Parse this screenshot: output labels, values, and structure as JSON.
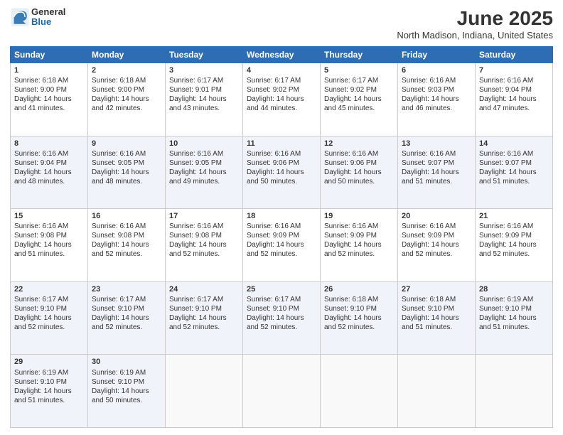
{
  "header": {
    "logo_general": "General",
    "logo_blue": "Blue",
    "month_year": "June 2025",
    "location": "North Madison, Indiana, United States"
  },
  "days_of_week": [
    "Sunday",
    "Monday",
    "Tuesday",
    "Wednesday",
    "Thursday",
    "Friday",
    "Saturday"
  ],
  "weeks": [
    [
      {
        "day": "1",
        "sunrise": "6:18 AM",
        "sunset": "9:00 PM",
        "daylight": "14 hours and 41 minutes."
      },
      {
        "day": "2",
        "sunrise": "6:18 AM",
        "sunset": "9:00 PM",
        "daylight": "14 hours and 42 minutes."
      },
      {
        "day": "3",
        "sunrise": "6:17 AM",
        "sunset": "9:01 PM",
        "daylight": "14 hours and 43 minutes."
      },
      {
        "day": "4",
        "sunrise": "6:17 AM",
        "sunset": "9:02 PM",
        "daylight": "14 hours and 44 minutes."
      },
      {
        "day": "5",
        "sunrise": "6:17 AM",
        "sunset": "9:02 PM",
        "daylight": "14 hours and 45 minutes."
      },
      {
        "day": "6",
        "sunrise": "6:16 AM",
        "sunset": "9:03 PM",
        "daylight": "14 hours and 46 minutes."
      },
      {
        "day": "7",
        "sunrise": "6:16 AM",
        "sunset": "9:04 PM",
        "daylight": "14 hours and 47 minutes."
      }
    ],
    [
      {
        "day": "8",
        "sunrise": "6:16 AM",
        "sunset": "9:04 PM",
        "daylight": "14 hours and 48 minutes."
      },
      {
        "day": "9",
        "sunrise": "6:16 AM",
        "sunset": "9:05 PM",
        "daylight": "14 hours and 48 minutes."
      },
      {
        "day": "10",
        "sunrise": "6:16 AM",
        "sunset": "9:05 PM",
        "daylight": "14 hours and 49 minutes."
      },
      {
        "day": "11",
        "sunrise": "6:16 AM",
        "sunset": "9:06 PM",
        "daylight": "14 hours and 50 minutes."
      },
      {
        "day": "12",
        "sunrise": "6:16 AM",
        "sunset": "9:06 PM",
        "daylight": "14 hours and 50 minutes."
      },
      {
        "day": "13",
        "sunrise": "6:16 AM",
        "sunset": "9:07 PM",
        "daylight": "14 hours and 51 minutes."
      },
      {
        "day": "14",
        "sunrise": "6:16 AM",
        "sunset": "9:07 PM",
        "daylight": "14 hours and 51 minutes."
      }
    ],
    [
      {
        "day": "15",
        "sunrise": "6:16 AM",
        "sunset": "9:08 PM",
        "daylight": "14 hours and 51 minutes."
      },
      {
        "day": "16",
        "sunrise": "6:16 AM",
        "sunset": "9:08 PM",
        "daylight": "14 hours and 52 minutes."
      },
      {
        "day": "17",
        "sunrise": "6:16 AM",
        "sunset": "9:08 PM",
        "daylight": "14 hours and 52 minutes."
      },
      {
        "day": "18",
        "sunrise": "6:16 AM",
        "sunset": "9:09 PM",
        "daylight": "14 hours and 52 minutes."
      },
      {
        "day": "19",
        "sunrise": "6:16 AM",
        "sunset": "9:09 PM",
        "daylight": "14 hours and 52 minutes."
      },
      {
        "day": "20",
        "sunrise": "6:16 AM",
        "sunset": "9:09 PM",
        "daylight": "14 hours and 52 minutes."
      },
      {
        "day": "21",
        "sunrise": "6:16 AM",
        "sunset": "9:09 PM",
        "daylight": "14 hours and 52 minutes."
      }
    ],
    [
      {
        "day": "22",
        "sunrise": "6:17 AM",
        "sunset": "9:10 PM",
        "daylight": "14 hours and 52 minutes."
      },
      {
        "day": "23",
        "sunrise": "6:17 AM",
        "sunset": "9:10 PM",
        "daylight": "14 hours and 52 minutes."
      },
      {
        "day": "24",
        "sunrise": "6:17 AM",
        "sunset": "9:10 PM",
        "daylight": "14 hours and 52 minutes."
      },
      {
        "day": "25",
        "sunrise": "6:17 AM",
        "sunset": "9:10 PM",
        "daylight": "14 hours and 52 minutes."
      },
      {
        "day": "26",
        "sunrise": "6:18 AM",
        "sunset": "9:10 PM",
        "daylight": "14 hours and 52 minutes."
      },
      {
        "day": "27",
        "sunrise": "6:18 AM",
        "sunset": "9:10 PM",
        "daylight": "14 hours and 51 minutes."
      },
      {
        "day": "28",
        "sunrise": "6:19 AM",
        "sunset": "9:10 PM",
        "daylight": "14 hours and 51 minutes."
      }
    ],
    [
      {
        "day": "29",
        "sunrise": "6:19 AM",
        "sunset": "9:10 PM",
        "daylight": "14 hours and 51 minutes."
      },
      {
        "day": "30",
        "sunrise": "6:19 AM",
        "sunset": "9:10 PM",
        "daylight": "14 hours and 50 minutes."
      },
      null,
      null,
      null,
      null,
      null
    ]
  ],
  "labels": {
    "sunrise": "Sunrise: ",
    "sunset": "Sunset: ",
    "daylight": "Daylight: "
  }
}
